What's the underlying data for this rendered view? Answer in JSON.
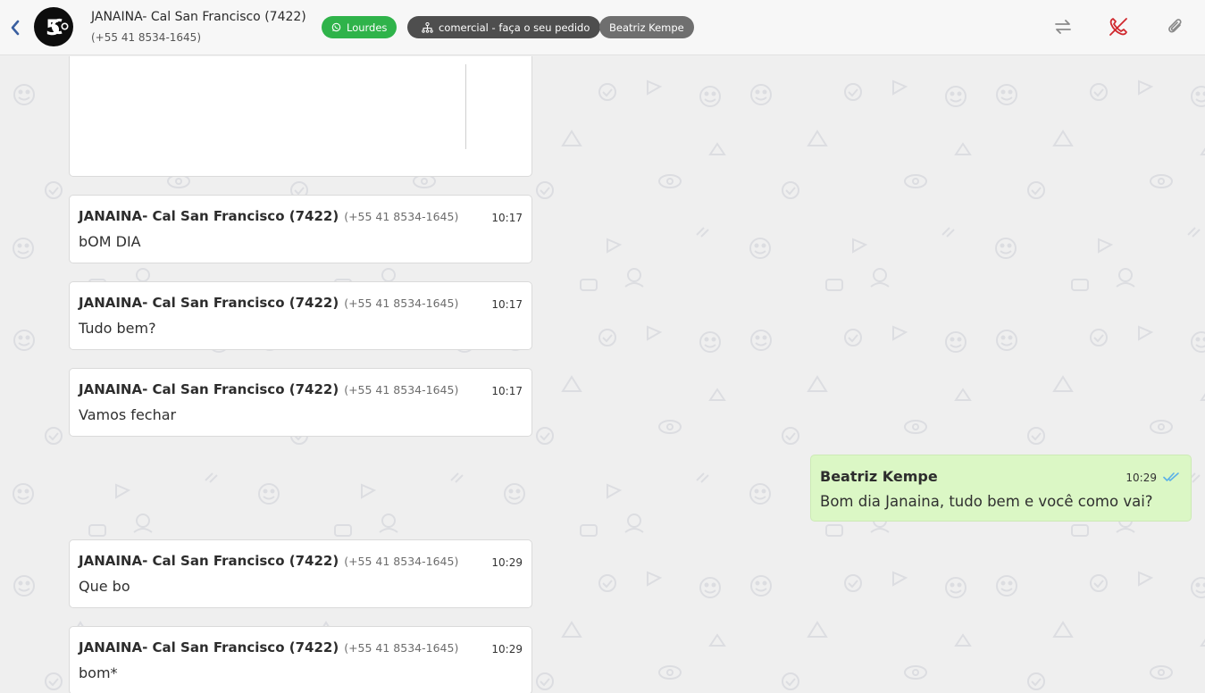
{
  "header": {
    "contact_name": "JANAINA- Cal San Francisco (7422)",
    "contact_phone": "(+55 41 8534-1645)",
    "tags": {
      "channel": "Lourdes",
      "queue": "comercial - faça o seu pedido",
      "user": "Beatriz Kempe"
    },
    "icons": {
      "back": "chevron-left-icon",
      "transfer": "transfer-arrows-icon",
      "end_call": "phone-hangup-icon",
      "attach": "paperclip-icon"
    }
  },
  "messages": [
    {
      "sender": "JANAINA- Cal San Francisco (7422)",
      "phone": "(+55 41 8534-1645)",
      "time": "10:17",
      "text": "bOM DIA"
    },
    {
      "sender": "JANAINA- Cal San Francisco (7422)",
      "phone": "(+55 41 8534-1645)",
      "time": "10:17",
      "text": "Tudo bem?"
    },
    {
      "sender": "JANAINA- Cal San Francisco (7422)",
      "phone": "(+55 41 8534-1645)",
      "time": "10:17",
      "text": "Vamos fechar"
    },
    {
      "sender": "Beatriz Kempe",
      "time": "10:29",
      "text": "Bom dia Janaina, tudo bem e você como vai?"
    },
    {
      "sender": "JANAINA- Cal San Francisco (7422)",
      "phone": "(+55 41 8534-1645)",
      "time": "10:29",
      "text": "Que bo"
    },
    {
      "sender": "JANAINA- Cal San Francisco (7422)",
      "phone": "(+55 41 8534-1645)",
      "time": "10:29",
      "text": "bom*"
    }
  ],
  "colors": {
    "whatsapp_green": "#2fb34a",
    "outgoing_bubble": "#dbf7c5",
    "read_check": "#5ab0e8",
    "end_call_red": "#d0282e"
  }
}
